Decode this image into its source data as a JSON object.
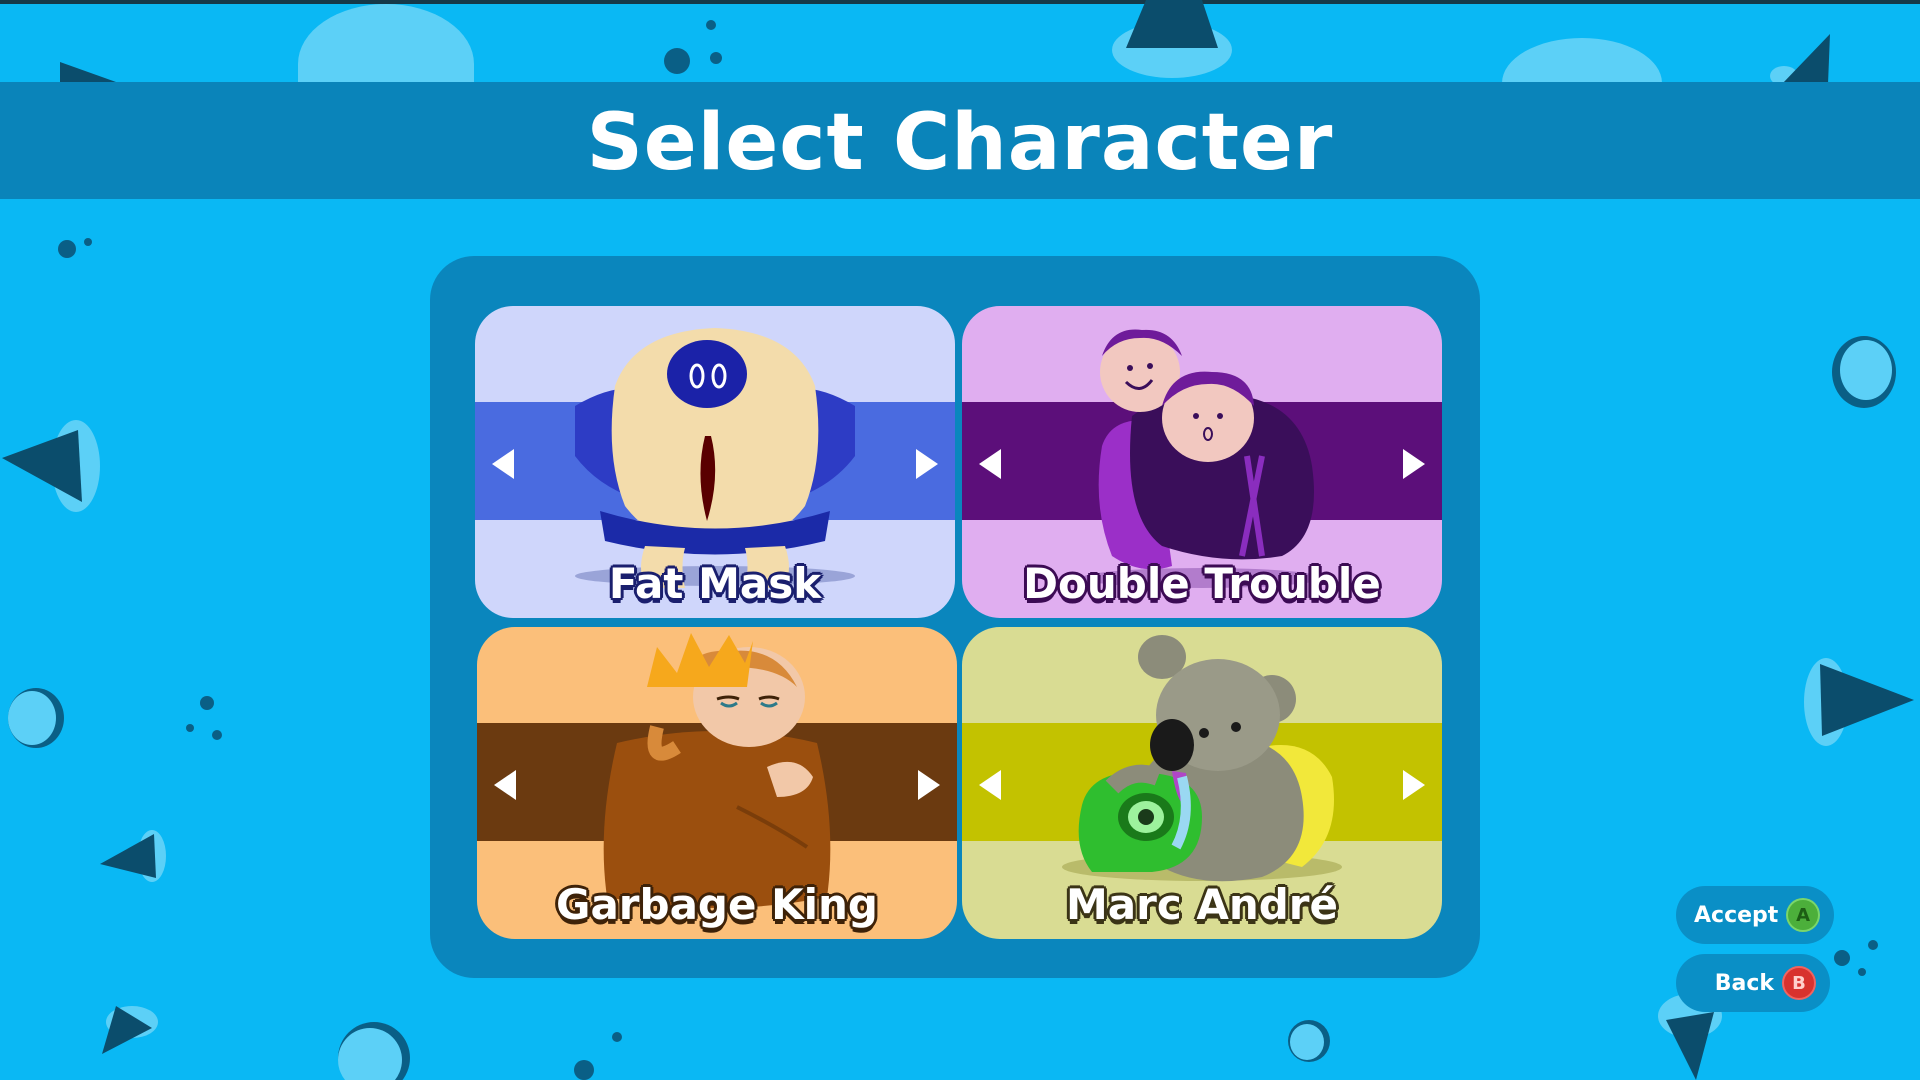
{
  "screen": {
    "title": "Select Character"
  },
  "colors": {
    "background": "#0ab8f4",
    "header_band": "#0a84ba",
    "panel": "#0a86bd",
    "accept_button": "#4caf3b",
    "back_button": "#d8322e"
  },
  "characters": [
    {
      "name": "Fat Mask",
      "card_color": "#cfd6fb",
      "band_color": "#4a6be0",
      "outline_color": "#1a1f6e",
      "icon": "masked-blob-character-icon"
    },
    {
      "name": "Double Trouble",
      "card_color": "#e0aef0",
      "band_color": "#5c0f7a",
      "outline_color": "#3c0b54",
      "icon": "twin-heads-character-icon"
    },
    {
      "name": "Garbage King",
      "card_color": "#fbbf7a",
      "band_color": "#6b3a10",
      "outline_color": "#3e2208",
      "icon": "crowned-bag-character-icon"
    },
    {
      "name": "Marc André",
      "card_color": "#d9dc93",
      "band_color": "#c3c200",
      "outline_color": "#3b3416",
      "icon": "koala-character-icon"
    }
  ],
  "prompts": {
    "accept_label": "Accept",
    "accept_button": "A",
    "back_label": "Back",
    "back_button": "B"
  }
}
